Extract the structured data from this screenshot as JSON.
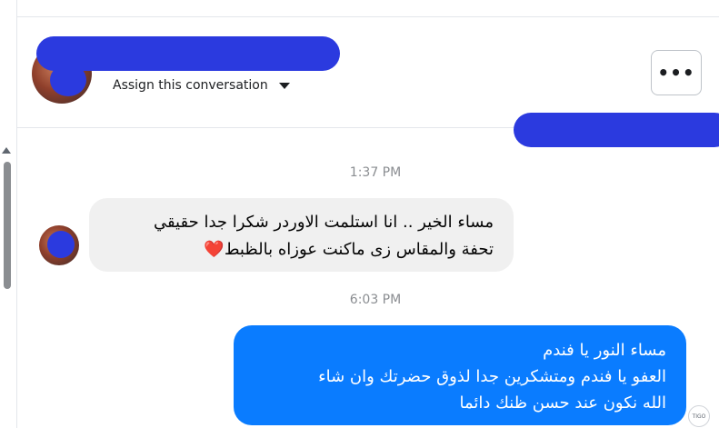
{
  "header": {
    "assign_label": "Assign this conversation",
    "more_label": "•••"
  },
  "messages": [
    {
      "timestamp": "1:37 PM"
    },
    {
      "direction": "incoming",
      "lines": [
        "مساء الخير .. انا استلمت الاوردر شكرا جدا حقيقي",
        "تحفة والمقاس زى ماكنت عوزاه بالظبط"
      ],
      "emoji": "❤️"
    },
    {
      "timestamp": "6:03 PM"
    },
    {
      "direction": "outgoing",
      "lines": [
        "مساء النور يا فندم",
        "العفو يا فندم ومتشكرين جدا لذوق حضرتك وان شاء",
        "الله نكون عند حسن ظنك دائما"
      ]
    }
  ],
  "badge_text": "TIGO",
  "colors": {
    "outgoing_bubble": "#0a7cff",
    "incoming_bubble": "#f0f0f0",
    "redaction": "#2b3adf"
  }
}
